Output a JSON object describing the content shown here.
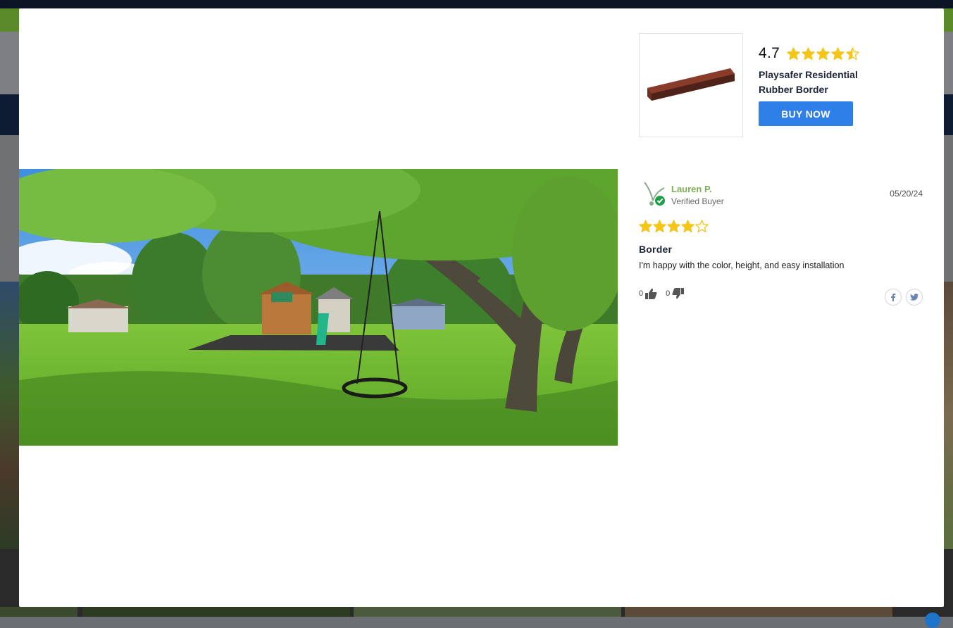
{
  "product": {
    "rating": "4.7",
    "rating_stars": 4.5,
    "name": "Playsafer Residential Rubber Border",
    "buy_label": "BUY NOW",
    "image_icon": "rubber-border-image",
    "border_color": "#6b2f22"
  },
  "review": {
    "author": "Lauren P.",
    "badge": "Verified Buyer",
    "date": "05/20/24",
    "stars": 4,
    "title": "Border",
    "body": "I'm happy with the color, height, and easy installation",
    "helpful_up": "0",
    "helpful_down": "0"
  },
  "share": {
    "facebook_icon": "facebook-icon",
    "twitter_icon": "twitter-icon"
  },
  "colors": {
    "accent": "#2f7fe8",
    "star": "#f5c518",
    "reviewer_name": "#7fae56",
    "verified_check": "#1f9e4a"
  }
}
